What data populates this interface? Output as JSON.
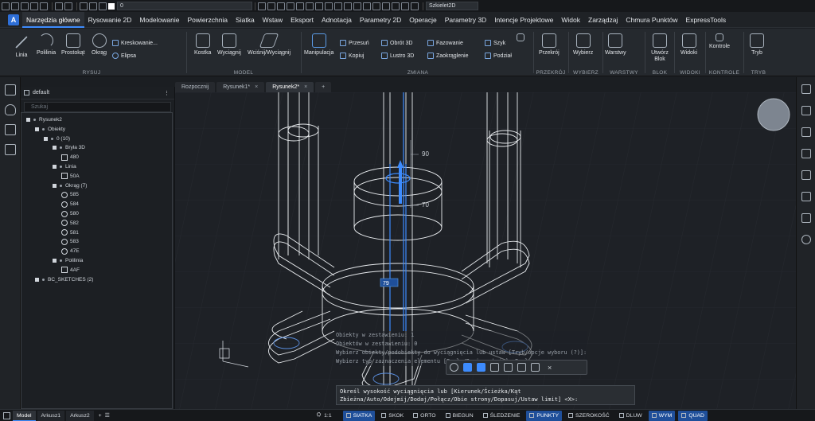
{
  "qat": {
    "layer_value": "0",
    "visual_style": "Szkielet2D"
  },
  "menubar": {
    "items": [
      "Narzędzia główne",
      "Rysowanie 2D",
      "Modelowanie",
      "Powierzchnia",
      "Siatka",
      "Wstaw",
      "Eksport",
      "Adnotacja",
      "Parametry 2D",
      "Operacje",
      "Parametry 3D",
      "Intencje Projektowe",
      "Widok",
      "Zarządzaj",
      "Chmura Punktów",
      "ExpressTools"
    ],
    "active": "Narzędzia główne"
  },
  "ribbon": {
    "rysuj": {
      "title": "RYSUJ",
      "linia": "Linia",
      "polilinia": "Polilinia",
      "prostokat": "Prostokąt",
      "okrag": "Okrąg",
      "kreskowanie": "Kreskowanie...",
      "elipsa": "Elipsa"
    },
    "model": {
      "title": "MODEL",
      "kostka": "Kostka",
      "wyciagnij": "Wyciągnij",
      "wcisnij": "Wciśnij/Wyciągnij"
    },
    "zmiana": {
      "title": "ZMIANA",
      "manipulacja": "Manipulacja",
      "przesun": "Przesuń",
      "kopiuj": "Kopiuj",
      "obrot3d": "Obrót 3D",
      "lustro3d": "Lustro 3D",
      "fazowanie": "Fazowanie",
      "zaokraglenie": "Zaokrąglenie",
      "szyk": "Szyk",
      "podzial": "Podział"
    },
    "przekroj": {
      "title": "PRZEKRÓJ",
      "label": "Przekrój"
    },
    "wybierz": {
      "title": "WYBIERZ",
      "label": "Wybierz"
    },
    "warstwy": {
      "title": "WARSTWY",
      "label": "Warstwy"
    },
    "blok": {
      "title": "BLOK",
      "label": "Utwórz Blok"
    },
    "widoki": {
      "title": "WIDOKI",
      "label": "Widoki"
    },
    "kontrole": {
      "title": "KONTROLE",
      "label": "Kontrole"
    },
    "tryb": {
      "title": "TRYB",
      "label": "Tryb"
    }
  },
  "panel": {
    "header": "default",
    "search_placeholder": "Szukaj",
    "tree": [
      {
        "label": "Rysunek2",
        "indent": 0,
        "kind": "root"
      },
      {
        "label": "Obiekty",
        "indent": 1,
        "kind": "group"
      },
      {
        "label": "0 (10)",
        "indent": 2,
        "kind": "group"
      },
      {
        "label": "Bryła 3D",
        "indent": 3,
        "kind": "group"
      },
      {
        "label": "480",
        "indent": 4,
        "kind": "solid"
      },
      {
        "label": "Linia",
        "indent": 3,
        "kind": "group"
      },
      {
        "label": "50A",
        "indent": 4,
        "kind": "line"
      },
      {
        "label": "Okrąg (7)",
        "indent": 3,
        "kind": "group"
      },
      {
        "label": "585",
        "indent": 4,
        "kind": "circle"
      },
      {
        "label": "584",
        "indent": 4,
        "kind": "circle"
      },
      {
        "label": "580",
        "indent": 4,
        "kind": "circle"
      },
      {
        "label": "582",
        "indent": 4,
        "kind": "circle"
      },
      {
        "label": "581",
        "indent": 4,
        "kind": "circle"
      },
      {
        "label": "583",
        "indent": 4,
        "kind": "circle"
      },
      {
        "label": "47E",
        "indent": 4,
        "kind": "circle"
      },
      {
        "label": "Polilinia",
        "indent": 3,
        "kind": "group"
      },
      {
        "label": "4AF",
        "indent": 4,
        "kind": "poly"
      },
      {
        "label": "BC_SKETCHES (2)",
        "indent": 1,
        "kind": "group"
      }
    ]
  },
  "doc_tabs": [
    "Rozpocznij",
    "Rysunek1*",
    "Rysunek2*"
  ],
  "active_doc_tab": "Rysunek2*",
  "viewport": {
    "ruler_90": "90",
    "ruler_70": "70",
    "dim_value": "79"
  },
  "command": {
    "history": [
      "Obiekty w zestawieniu: 1",
      "Obiektów w zestawieniu: 0",
      "Wybierz obiekty/podobiekty do wyciągnięcia lub ustaw [Tryb/opcje wyboru (?)]: _mo",
      "Wybierz typ zaznaczenia elementu [Bryła/Powierzchnia] <Bryła>: _so"
    ],
    "prompt": "Określ wysokość wyciągnięcia lub [Kierunek/Ścieżka/Kąt",
    "prompt2": "Zbieżna/Auto/Odejmij/Dodaj/Połącz/Obie strony/Dopasuj/Ustaw limit] <X>:"
  },
  "status": {
    "tabs": [
      "Model",
      "Arkusz1",
      "Arkusz2"
    ],
    "active_tab": "Model",
    "scale": "1:1",
    "buttons": [
      "SIATKA",
      "SKOK",
      "ORTO",
      "BIEGUN",
      "ŚLEDZENIE",
      "PUNKTY",
      "SZEROKOŚĆ",
      "DLUW",
      "WYM",
      "QUAD"
    ],
    "on": [
      "SIATKA",
      "PUNKTY",
      "WYM",
      "QUAD"
    ]
  },
  "colors": {
    "accent": "#3d8bfd",
    "bg": "#1e2126",
    "wire": "#e8ebee"
  }
}
